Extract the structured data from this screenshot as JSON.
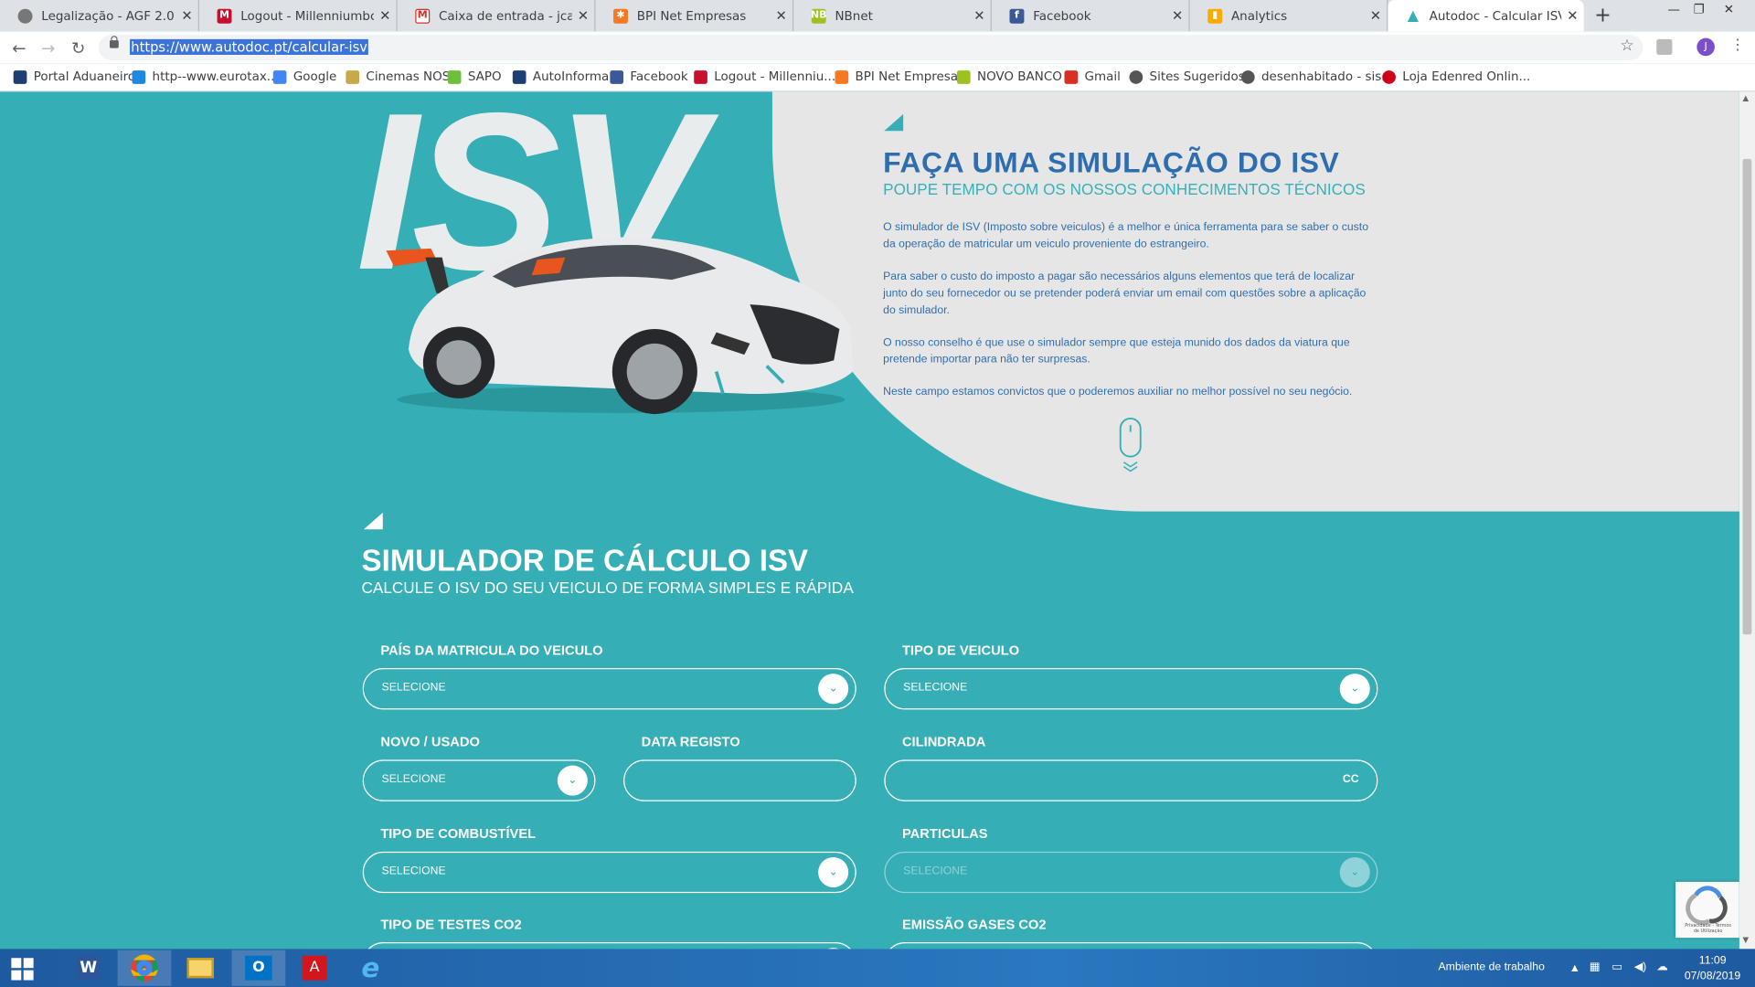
{
  "tabs": [
    {
      "title": "Legalização - AGF 2.0",
      "icon": "globe-icon"
    },
    {
      "title": "Logout - Millenniumbcp",
      "icon": "millennium-icon"
    },
    {
      "title": "Caixa de entrada - jca.sanche",
      "icon": "gmail-icon"
    },
    {
      "title": "BPI Net Empresas",
      "icon": "bpi-icon"
    },
    {
      "title": "NBnet",
      "icon": "nbnet-icon"
    },
    {
      "title": "Facebook",
      "icon": "facebook-icon"
    },
    {
      "title": "Analytics",
      "icon": "analytics-icon"
    },
    {
      "title": "Autodoc - Calcular ISV",
      "icon": "autodoc-icon"
    }
  ],
  "browser": {
    "url": "https://www.autodoc.pt/calcular-isv",
    "profile_initial": "J"
  },
  "bookmarks": [
    "Portal Aduaneiro",
    "http--www.eurotax...",
    "Google",
    "Cinemas NOS",
    "SAPO",
    "AutoInforma",
    "Facebook",
    "Logout - Millenniu...",
    "BPI Net Empresas",
    "NOVO BANCO",
    "Gmail",
    "Sites Sugeridos",
    "desenhabitado - sis...",
    "Loja Edenred Onlin..."
  ],
  "hero": {
    "big_text": "ISV",
    "title": "FAÇA UMA SIMULAÇÃO DO ISV",
    "subtitle": "POUPE TEMPO COM OS NOSSOS CONHECIMENTOS TÉCNICOS",
    "paragraphs": [
      "O simulador de ISV (Imposto sobre veiculos) é a melhor e única ferramenta para se saber o custo da operação de matricular um veiculo proveniente do estrangeiro.",
      "Para saber o custo do imposto a pagar são necessários alguns elementos que terá de localizar junto do seu fornecedor ou se pretender poderá enviar um email com questões sobre a aplicação do simulador.",
      "O nosso conselho é que use o simulador sempre que esteja munido dos dados da viatura que pretende importar para não ter surpresas.",
      "Neste campo estamos convictos que o poderemos auxiliar no melhor possível no seu negócio."
    ]
  },
  "simulator": {
    "title": "SIMULADOR DE CÁLCULO ISV",
    "subtitle": "CALCULE O ISV DO SEU VEICULO DE FORMA SIMPLES E RÁPIDA",
    "select_placeholder": "SELECIONE",
    "fields": {
      "pais": "PAÍS DA MATRICULA DO VEICULO",
      "tipo_veiculo": "TIPO DE VEICULO",
      "novo_usado": "NOVO / USADO",
      "data_registo": "DATA REGISTO",
      "cilindrada": "CILINDRADA",
      "cilindrada_unit": "CC",
      "combustivel": "TIPO DE COMBUSTÍVEL",
      "particulas": "PARTICULAS",
      "testes_co2": "TIPO DE TESTES CO2",
      "emissao_co2": "EMISSÃO GASES CO2"
    }
  },
  "recaptcha": {
    "text": "Privacidade - Termos de Utilização"
  },
  "taskbar": {
    "desktop_label": "Ambiente de trabalho",
    "time": "11:09",
    "date": "07/08/2019"
  },
  "colors": {
    "page_bg": "#35aeb5",
    "hero_bg": "#e6e6e6",
    "title_blue": "#2e6eae"
  }
}
